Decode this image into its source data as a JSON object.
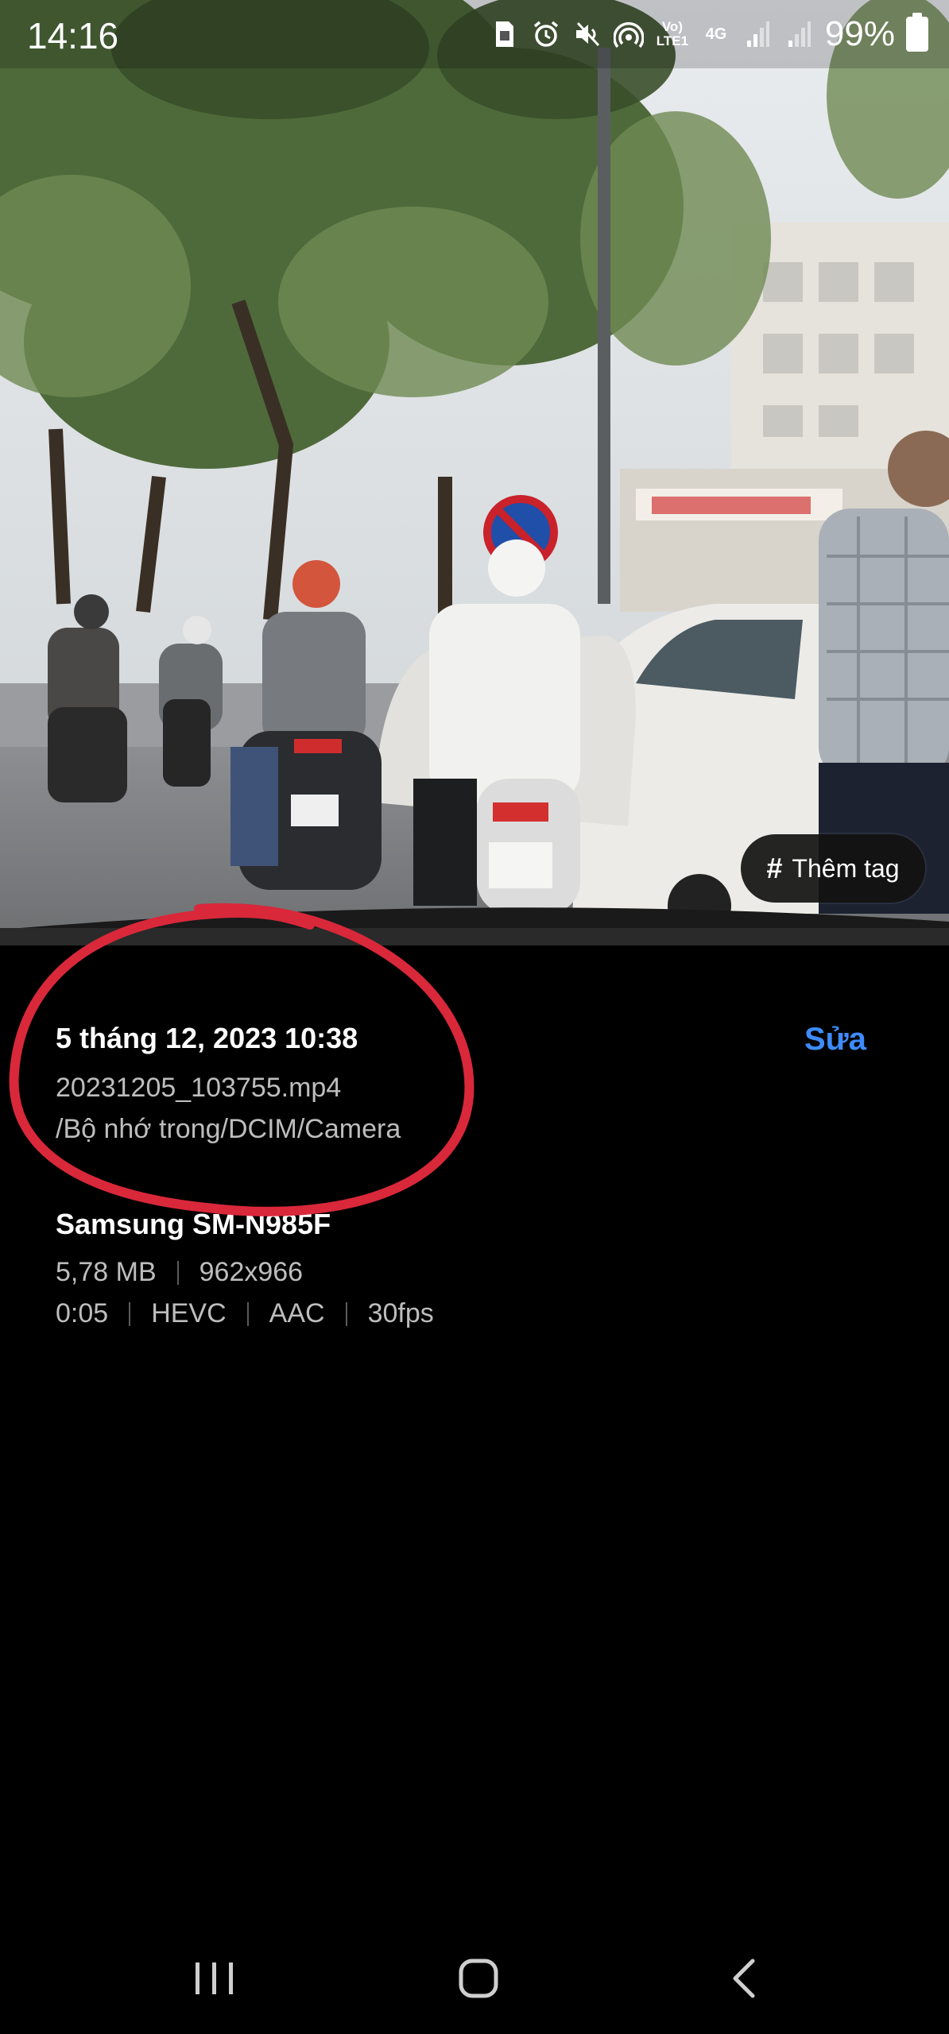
{
  "status_bar": {
    "time": "14:16",
    "icons": [
      "sim-icon",
      "alarm-icon",
      "mute-icon",
      "hotspot-icon",
      "volte-icon",
      "4g-data-icon",
      "signal-1-icon",
      "signal-2-icon",
      "battery-icon"
    ],
    "volte_label": "Vo) LTE1",
    "network_label": "4G",
    "battery": "99%"
  },
  "photo": {
    "description_icon": "street-scene-image",
    "tag_button": {
      "icon": "hash-icon",
      "label": "Thêm tag"
    }
  },
  "details": {
    "date": "5 tháng 12, 2023 10:38",
    "edit_label": "Sửa",
    "filename": "20231205_103755.mp4",
    "path": "/Bộ nhớ trong/DCIM/Camera",
    "device": "Samsung SM-N985F",
    "size": "5,78 MB",
    "resolution": "962x966",
    "duration": "0:05",
    "video_codec": "HEVC",
    "audio_codec": "AAC",
    "fps": "30fps"
  },
  "nav_bar": {
    "recents_icon": "recents-icon",
    "home_icon": "home-icon",
    "back_icon": "back-icon"
  },
  "colors": {
    "accent": "#3d8bfd",
    "annotation": "#d9283a",
    "background": "#000000"
  }
}
